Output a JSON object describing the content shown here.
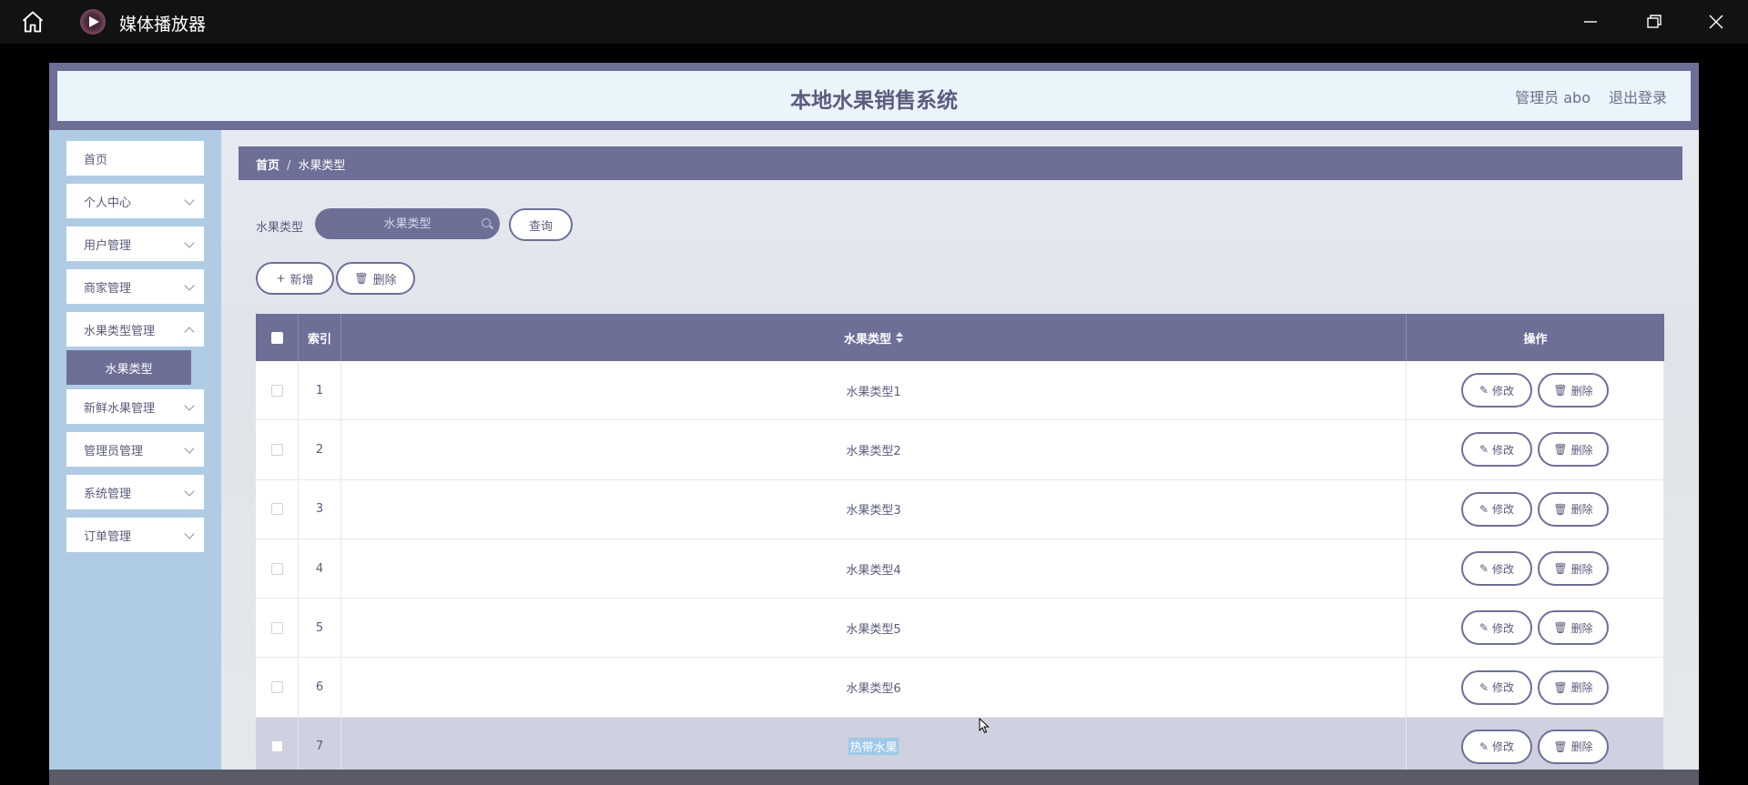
{
  "window": {
    "title": "媒体播放器"
  },
  "header": {
    "system_title": "本地水果销售系统",
    "user_label": "管理员 abo",
    "logout_label": "退出登录"
  },
  "sidebar": {
    "items": [
      {
        "label": "首页"
      },
      {
        "label": "个人中心"
      },
      {
        "label": "用户管理"
      },
      {
        "label": "商家管理"
      },
      {
        "label": "水果类型管理"
      },
      {
        "label": "新鲜水果管理"
      },
      {
        "label": "管理员管理"
      },
      {
        "label": "系统管理"
      },
      {
        "label": "订单管理"
      }
    ],
    "active_sub": "水果类型"
  },
  "breadcrumb": {
    "home": "首页",
    "separator": "/",
    "current": "水果类型"
  },
  "search": {
    "label": "水果类型",
    "placeholder": "水果类型",
    "query_button": "查询"
  },
  "actions": {
    "add": "新增",
    "delete": "删除"
  },
  "table": {
    "headers": {
      "index": "索引",
      "type": "水果类型",
      "operation": "操作"
    },
    "edit_label": "修改",
    "delete_label": "删除",
    "rows": [
      {
        "index": "1",
        "type": "水果类型1"
      },
      {
        "index": "2",
        "type": "水果类型2"
      },
      {
        "index": "3",
        "type": "水果类型3"
      },
      {
        "index": "4",
        "type": "水果类型4"
      },
      {
        "index": "5",
        "type": "水果类型5"
      },
      {
        "index": "6",
        "type": "水果类型6"
      },
      {
        "index": "7",
        "type": "热带水果"
      }
    ],
    "selected_row": 7
  },
  "colors": {
    "accent": "#6e6f97",
    "sidebar_bg": "#b0cce5",
    "header_bg": "#eaf4fb"
  }
}
